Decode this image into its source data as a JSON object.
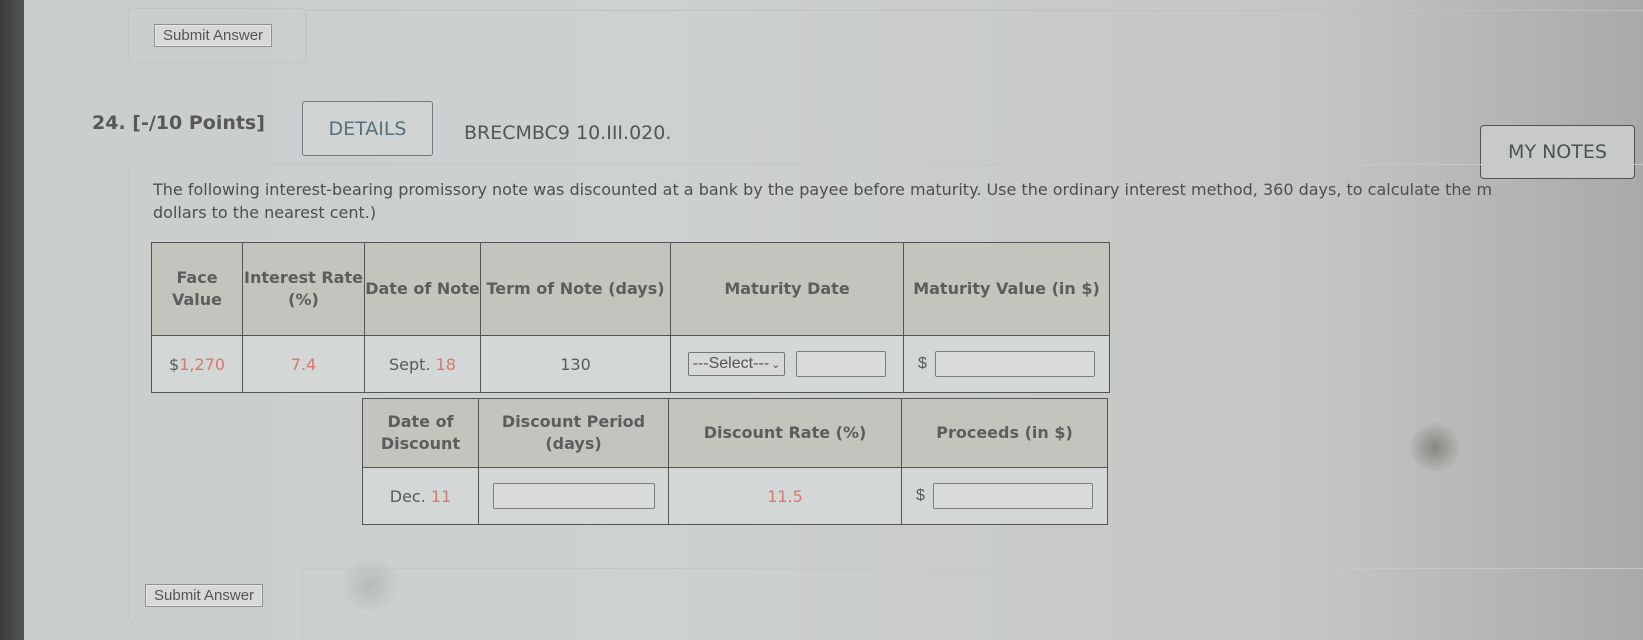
{
  "previous_question": {
    "submit_label": "Submit Answer"
  },
  "question": {
    "number_points": "24. [-/10 Points]",
    "details_label": "DETAILS",
    "problem_id": "BRECMBC9 10.III.020.",
    "my_notes_label": "MY NOTES",
    "prompt_line1": "The following interest-bearing promissory note was discounted at a bank by the payee before maturity. Use the ordinary interest method, 360 days, to calculate the m",
    "prompt_line2": "dollars to the nearest cent.)",
    "submit_label": "Submit Answer"
  },
  "table1": {
    "headers": {
      "face_value": "Face Value",
      "interest_rate": "Interest Rate (%)",
      "date_of_note": "Date of Note",
      "term_of_note": "Term of Note (days)",
      "maturity_date": "Maturity Date",
      "maturity_value": "Maturity Value (in $)"
    },
    "row": {
      "face_value_symbol": "$",
      "face_value": "1,270",
      "interest_rate": "7.4",
      "date_month": "Sept.",
      "date_day": "18",
      "term_days": "130",
      "maturity_month_select": "---Select---",
      "maturity_day_value": "",
      "maturity_value_symbol": "$",
      "maturity_value": ""
    }
  },
  "table2": {
    "headers": {
      "date_of_discount": "Date of Discount",
      "discount_period": "Discount Period (days)",
      "discount_rate": "Discount Rate (%)",
      "proceeds": "Proceeds (in $)"
    },
    "row": {
      "discount_month": "Dec.",
      "discount_day": "11",
      "discount_period_value": "",
      "discount_rate": "11.5",
      "proceeds_symbol": "$",
      "proceeds_value": ""
    }
  },
  "colors": {
    "given_value": "#d9786f",
    "header_bg": "#c3c4bd",
    "details_text": "#56707d"
  }
}
